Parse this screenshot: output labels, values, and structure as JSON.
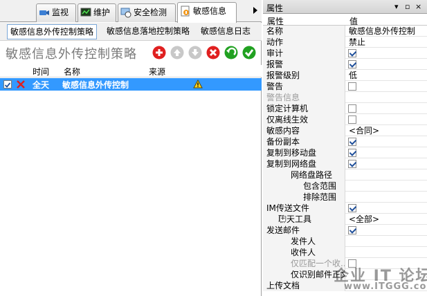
{
  "tabs": [
    {
      "label": "监视",
      "icon": "monitor-camera-icon"
    },
    {
      "label": "维护",
      "icon": "maintenance-icon"
    },
    {
      "label": "安全检测",
      "icon": "security-check-icon"
    },
    {
      "label": "敏感信息",
      "icon": "sensitive-info-icon",
      "active": true
    }
  ],
  "subtabs": [
    {
      "label": "敏感信息外传控制策略",
      "active": true
    },
    {
      "label": "敏感信息落地控制策略"
    },
    {
      "label": "敏感信息日志"
    }
  ],
  "page_title": "敏感信息外传控制策略",
  "toolbar_buttons": [
    {
      "icon": "add-icon",
      "color": "#e02020"
    },
    {
      "icon": "move-up-icon",
      "color": "#c8c8c8"
    },
    {
      "icon": "move-down-icon",
      "color": "#c8c8c8"
    },
    {
      "icon": "delete-icon",
      "color": "#e02020"
    },
    {
      "icon": "undo-icon",
      "color": "#21a121"
    },
    {
      "icon": "apply-icon",
      "color": "#21a121"
    }
  ],
  "grid": {
    "columns": [
      "时间",
      "名称",
      "来源"
    ],
    "rows": [
      {
        "time": "全天",
        "name": "敏感信息外传控制",
        "source": "",
        "checked": true,
        "action_icon": "block-x-icon",
        "warning_icon": "warning-icon"
      }
    ]
  },
  "panel": {
    "title": "属性",
    "controls": [
      "▾",
      "▫",
      "×"
    ]
  },
  "props_header": {
    "name": "属性",
    "value": "值"
  },
  "properties": [
    {
      "name": "名称",
      "value": "敏感信息外传控制"
    },
    {
      "name": "动作",
      "value": "禁止"
    },
    {
      "name": "审计",
      "check": true
    },
    {
      "name": "报警",
      "check": true
    },
    {
      "name": "报警级别",
      "value": "低"
    },
    {
      "name": "警告",
      "check": false
    },
    {
      "name": "警告信息",
      "value": "",
      "disabled": true
    },
    {
      "name": "锁定计算机",
      "check": false
    },
    {
      "name": "仅离线生效",
      "check": false
    },
    {
      "name": "敏感内容",
      "value": "<合同>"
    },
    {
      "name": "备份副本",
      "check": true
    },
    {
      "name": "复制到移动盘",
      "check": true
    },
    {
      "name": "复制到网络盘",
      "check": true
    },
    {
      "name": "网络盘路径",
      "value": "",
      "indent": 2
    },
    {
      "name": "包含范围",
      "value": "",
      "indent": 3
    },
    {
      "name": "排除范围",
      "value": "",
      "indent": 3
    },
    {
      "name": "IM传送文件",
      "check": true
    },
    {
      "name": "聊天工具",
      "value": "<全部>",
      "indent": 1,
      "expander": "+"
    },
    {
      "name": "发送邮件",
      "check": true
    },
    {
      "name": "发件人",
      "value": "",
      "indent": 2
    },
    {
      "name": "收件人",
      "value": "",
      "indent": 2
    },
    {
      "name": "仅匹配一个收...",
      "check": false,
      "indent": 2,
      "disabled": true
    },
    {
      "name": "仅识别邮件正文",
      "value": "",
      "indent": 2
    },
    {
      "name": "上传文档",
      "value": ""
    }
  ],
  "watermark": {
    "text": "企业 IT 论坛",
    "url": "www.ITGGG.com"
  }
}
